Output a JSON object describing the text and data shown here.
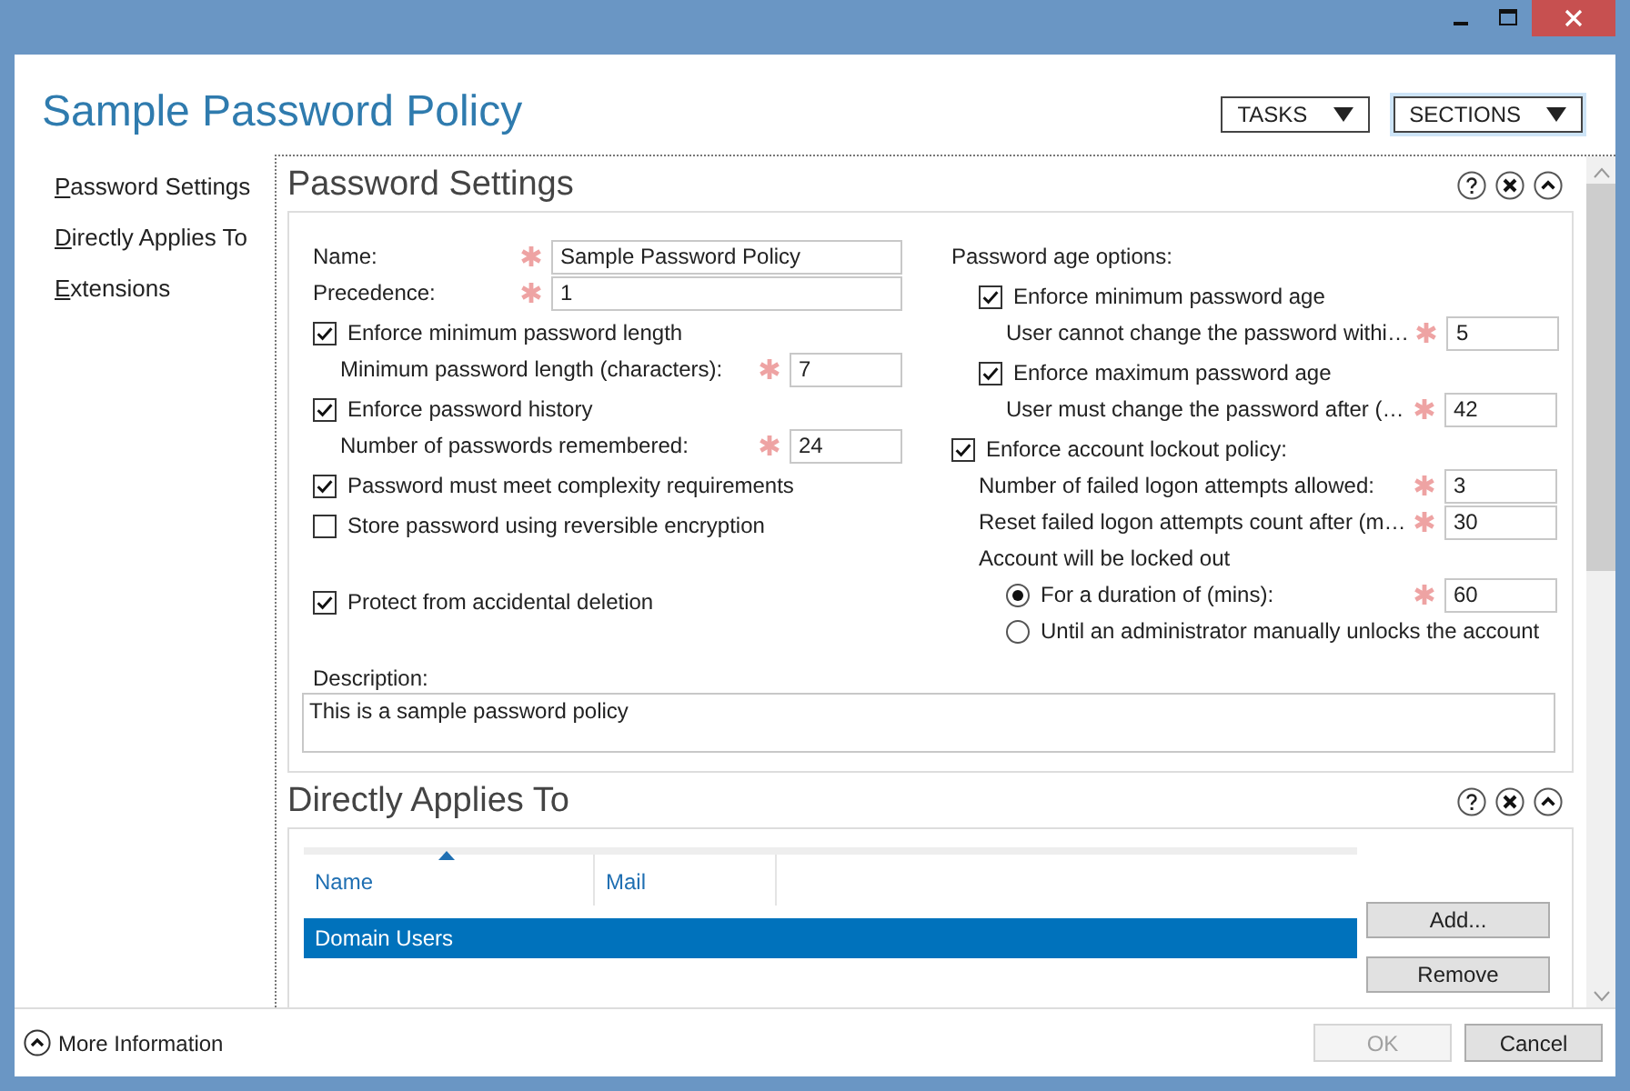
{
  "window": {
    "title": "Sample Password Policy"
  },
  "header_buttons": [
    {
      "label": "TASKS",
      "focused": false
    },
    {
      "label": "SECTIONS",
      "focused": true
    }
  ],
  "navigation": [
    {
      "label": "Password Settings"
    },
    {
      "label": "Directly Applies To"
    },
    {
      "label": "Extensions"
    }
  ],
  "password_settings": {
    "title": "Password Settings",
    "left": [
      {
        "kind": "field",
        "label": "Name:",
        "required": true,
        "value": "Sample Password Policy"
      },
      {
        "kind": "field",
        "label": "Precedence:",
        "required": true,
        "value": "1"
      },
      {
        "kind": "checkbox",
        "label": "Enforce minimum password length",
        "checked": true,
        "children": [
          {
            "kind": "field",
            "label": "Minimum password length (characters):",
            "required": true,
            "value": "7"
          }
        ]
      },
      {
        "kind": "checkbox",
        "label": "Enforce password history",
        "checked": true,
        "children": [
          {
            "kind": "field",
            "label": "Number of passwords remembered:",
            "required": true,
            "value": "24"
          }
        ]
      },
      {
        "kind": "checkbox",
        "label": "Password must meet complexity requirements",
        "checked": true
      },
      {
        "kind": "checkbox",
        "label": "Store password using reversible encryption",
        "checked": false
      }
    ],
    "protect": {
      "label": "Protect from accidental deletion",
      "checked": true
    },
    "right": [
      {
        "kind": "text",
        "label": "Password age options:",
        "children": [
          {
            "kind": "checkbox",
            "label": "Enforce minimum password age",
            "checked": true,
            "children": [
              {
                "kind": "field",
                "label": "User cannot change the password withi…",
                "required": true,
                "value": "5"
              }
            ]
          },
          {
            "kind": "checkbox",
            "label": "Enforce maximum password age",
            "checked": true,
            "children": [
              {
                "kind": "field",
                "label": "User must change the password after (…",
                "required": true,
                "value": "42"
              }
            ]
          }
        ]
      },
      {
        "kind": "checkbox",
        "label": "Enforce account lockout policy:",
        "checked": true,
        "children": [
          {
            "kind": "field",
            "label": "Number of failed logon attempts allowed:",
            "required": true,
            "value": "3"
          },
          {
            "kind": "field",
            "label": "Reset failed logon attempts count after (m…",
            "required": true,
            "value": "30"
          },
          {
            "kind": "text",
            "label": "Account will be locked out",
            "children": [
              {
                "kind": "radio",
                "label": "For a duration of (mins):",
                "selected": true,
                "required": true,
                "value": "60"
              },
              {
                "kind": "radio",
                "label": "Until an administrator manually unlocks the account",
                "selected": false
              }
            ]
          }
        ]
      }
    ],
    "description": {
      "label": "Description:",
      "value": "This is a sample password policy"
    }
  },
  "directly_applies_to": {
    "title": "Directly Applies To",
    "columns": [
      {
        "label": "Name",
        "sorted": true
      },
      {
        "label": "Mail",
        "sorted": false
      }
    ],
    "rows": [
      {
        "name": "Domain Users",
        "selected": true
      }
    ],
    "buttons": [
      "Add...",
      "Remove"
    ]
  },
  "footer": {
    "more_information": "More Information",
    "buttons": [
      {
        "label": "OK",
        "disabled": true
      },
      {
        "label": "Cancel",
        "disabled": false
      }
    ]
  }
}
